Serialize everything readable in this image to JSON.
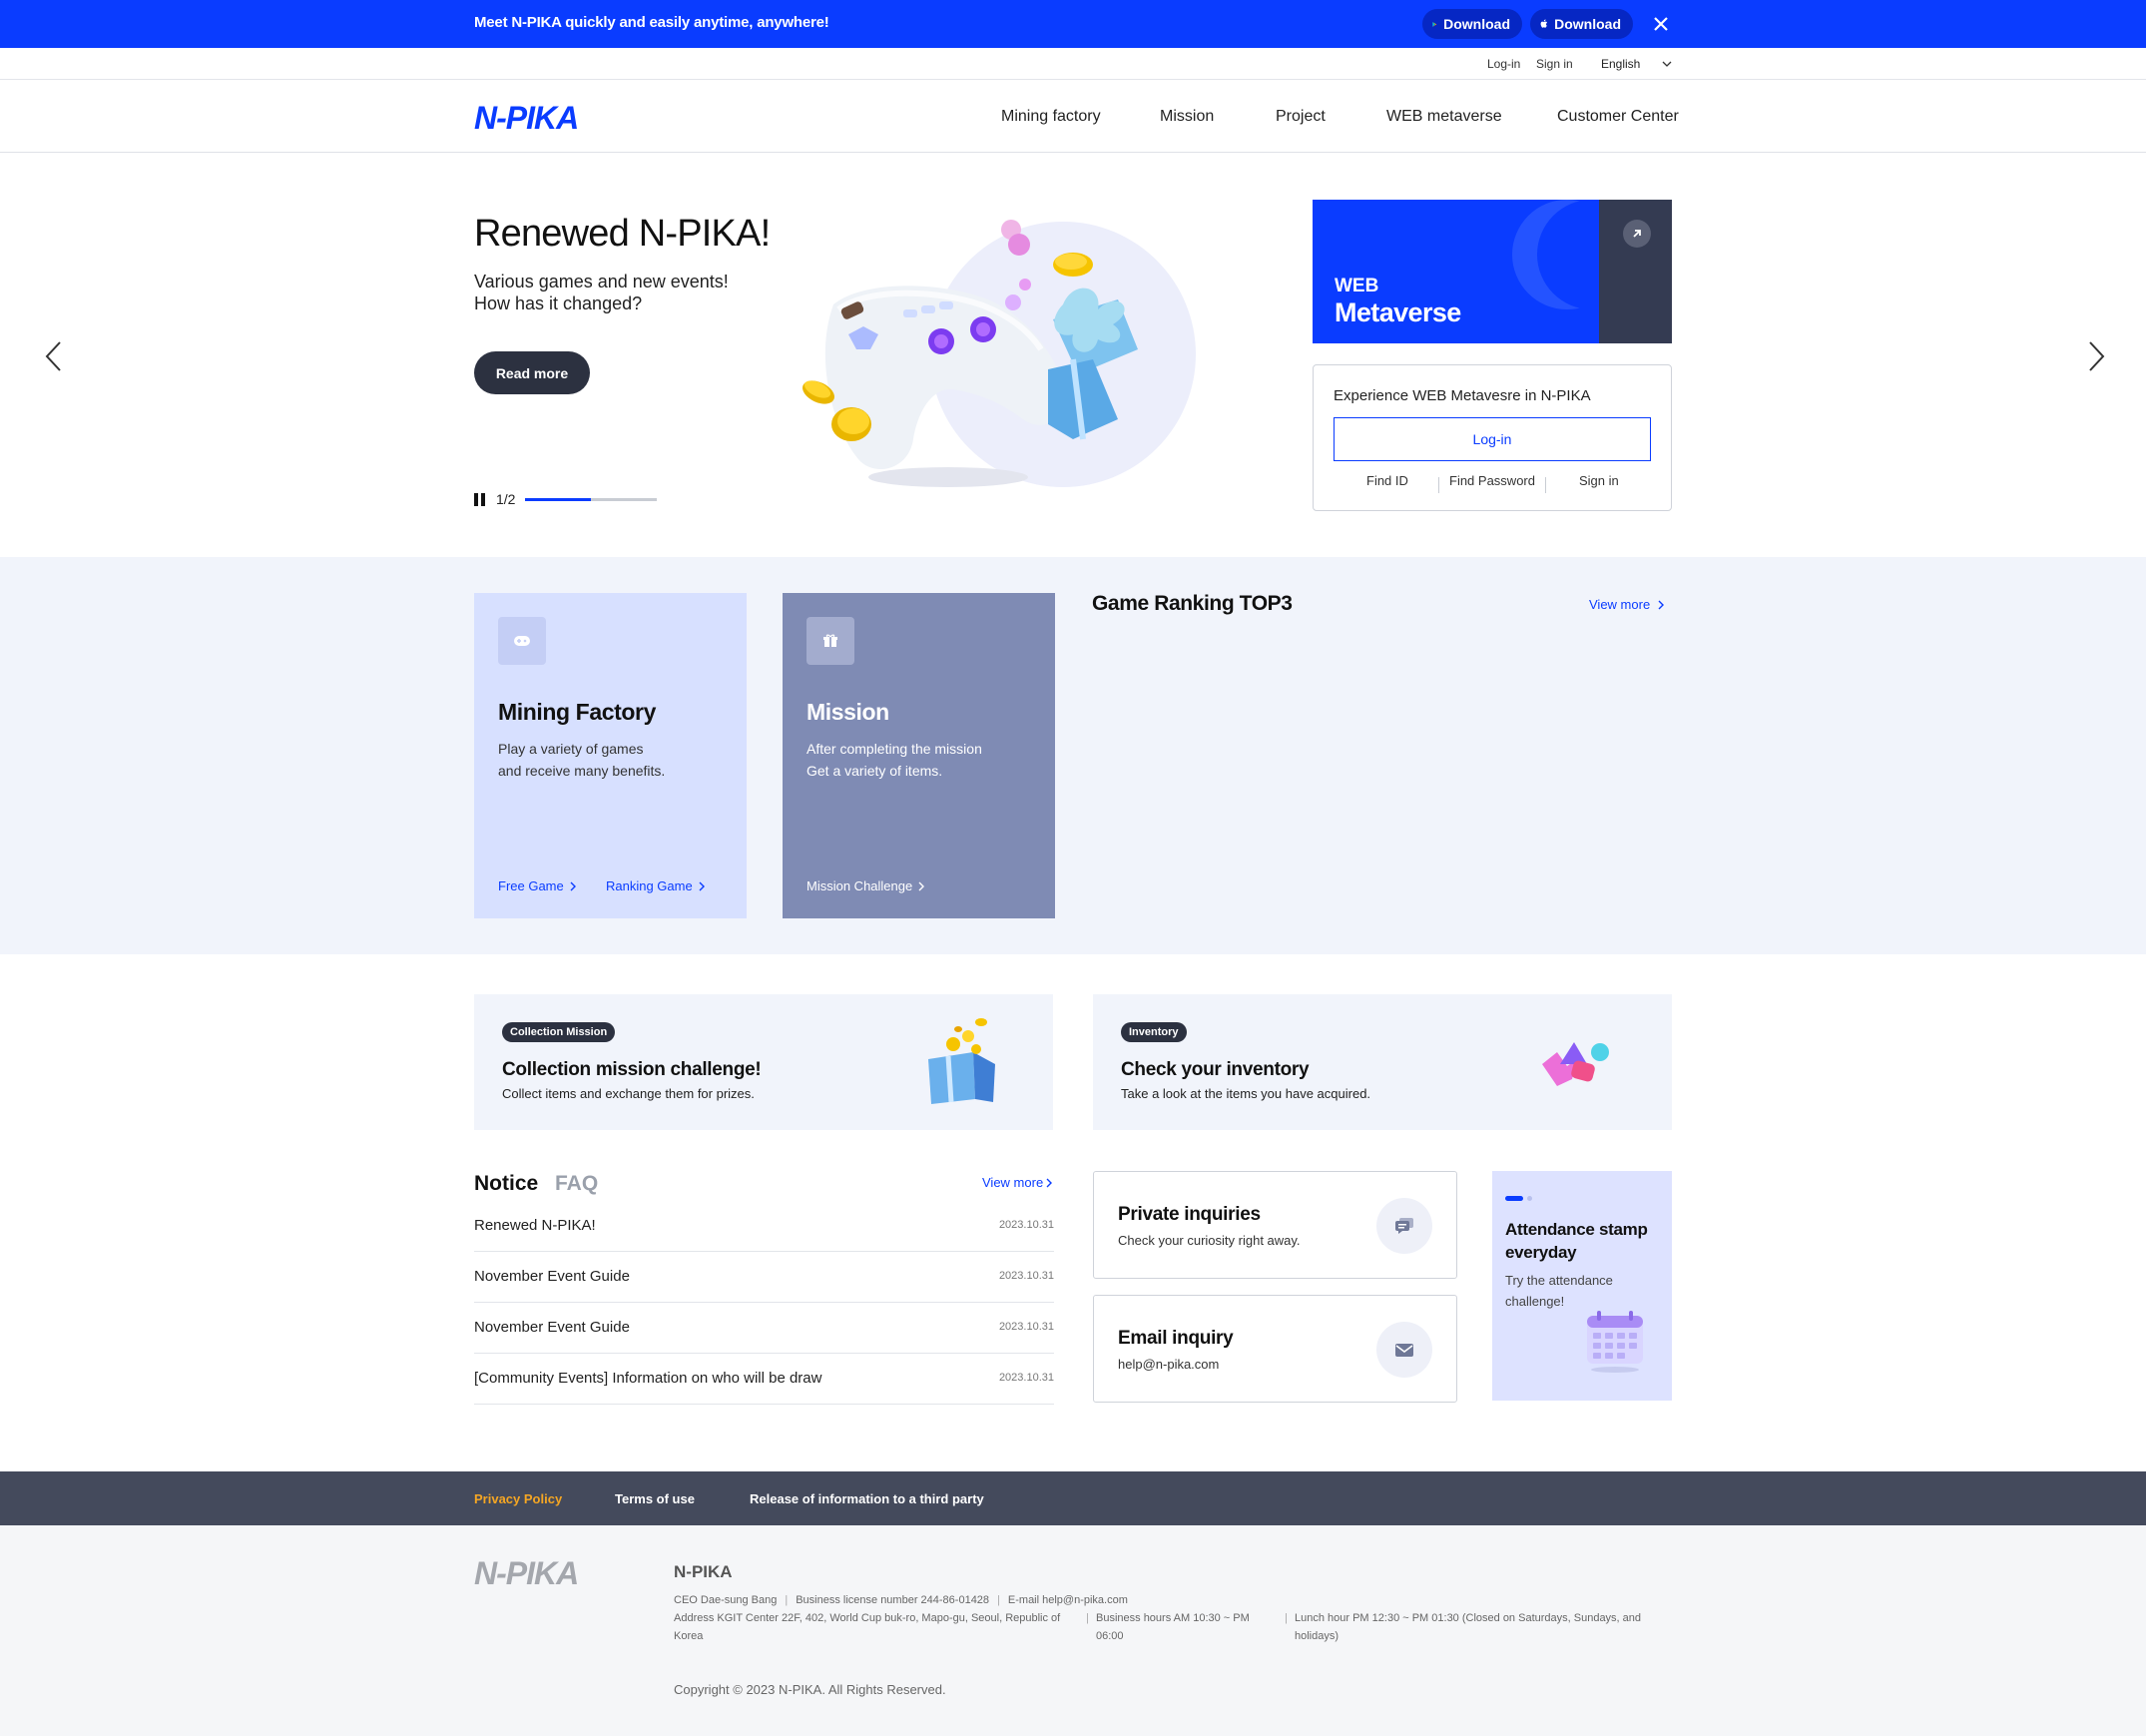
{
  "banner": {
    "message": "Meet N-PIKA quickly and easily anytime, anywhere!",
    "google_download": "Download",
    "apple_download": "Download",
    "colors": {
      "background": "#0a3cff"
    }
  },
  "util": {
    "login": "Log-in",
    "signin": "Sign in",
    "language": "English"
  },
  "header": {
    "logo": "N-PIKA",
    "nav": [
      "Mining factory",
      "Mission",
      "Project",
      "WEB metaverse",
      "Customer Center"
    ]
  },
  "hero": {
    "title": "Renewed N-PIKA!",
    "subtitle_line1": "Various games and new events!",
    "subtitle_line2": "How has it changed?",
    "read_more": "Read more",
    "pager": "1/2",
    "progress": 0.5
  },
  "metaverse": {
    "label1": "WEB",
    "label2": "Metaverse",
    "login_desc": "Experience WEB Metavesre in N-PIKA",
    "login_button": "Log-in",
    "links": [
      "Find ID",
      "Find Password",
      "Sign in"
    ]
  },
  "categories": {
    "mining": {
      "title": "Mining Factory",
      "desc_line1": "Play a variety of games",
      "desc_line2": "and receive many benefits.",
      "links": [
        "Free Game",
        "Ranking Game"
      ],
      "icon": "gamepad-icon"
    },
    "mission": {
      "title": "Mission",
      "desc_line1": "After completing the mission",
      "desc_line2": "Get a variety of items.",
      "links": [
        "Mission Challenge"
      ],
      "icon": "gift-icon"
    }
  },
  "ranking": {
    "title": "Game Ranking TOP3",
    "view_more": "View more"
  },
  "promos": {
    "collection": {
      "badge": "Collection Mission",
      "title": "Collection mission challenge!",
      "desc": "Collect items and exchange them for prizes."
    },
    "inventory": {
      "badge": "Inventory",
      "title": "Check your inventory",
      "desc": "Take a look at the items you have acquired."
    }
  },
  "notice": {
    "tab_notice": "Notice",
    "tab_faq": "FAQ",
    "view_more": "View more",
    "items": [
      {
        "title": "Renewed N-PIKA!",
        "date": "2023.10.31"
      },
      {
        "title": "November Event Guide",
        "date": "2023.10.31"
      },
      {
        "title": "November Event Guide",
        "date": "2023.10.31"
      },
      {
        "title": "[Community Events] Information on who will be draw",
        "date": "2023.10.31"
      }
    ]
  },
  "contact": {
    "private": {
      "title": "Private inquiries",
      "desc": "Check your curiosity right away."
    },
    "email": {
      "title": "Email inquiry",
      "desc": "help@n-pika.com"
    }
  },
  "attendance": {
    "title": "Attendance stamp everyday",
    "desc": "Try the attendance challenge!"
  },
  "footer": {
    "links": [
      "Privacy Policy",
      "Terms of use",
      "Release of information to a third party"
    ],
    "logo": "N-PIKA",
    "company": "N-PIKA",
    "ceo": "CEO Dae-sung Bang",
    "license": "Business license number 244-86-01428",
    "email": "E-mail help@n-pika.com",
    "address": "Address KGIT Center 22F, 402, World Cup buk-ro, Mapo-gu, Seoul, Republic of Korea",
    "hours": "Business hours AM 10:30 ~ PM 06:00",
    "lunch": "Lunch hour PM 12:30 ~ PM 01:30 (Closed on Saturdays, Sundays, and holidays)",
    "copyright": "Copyright © 2023 N-PIKA. All Rights Reserved.",
    "colors": {
      "privacy": "#f5a623"
    }
  }
}
